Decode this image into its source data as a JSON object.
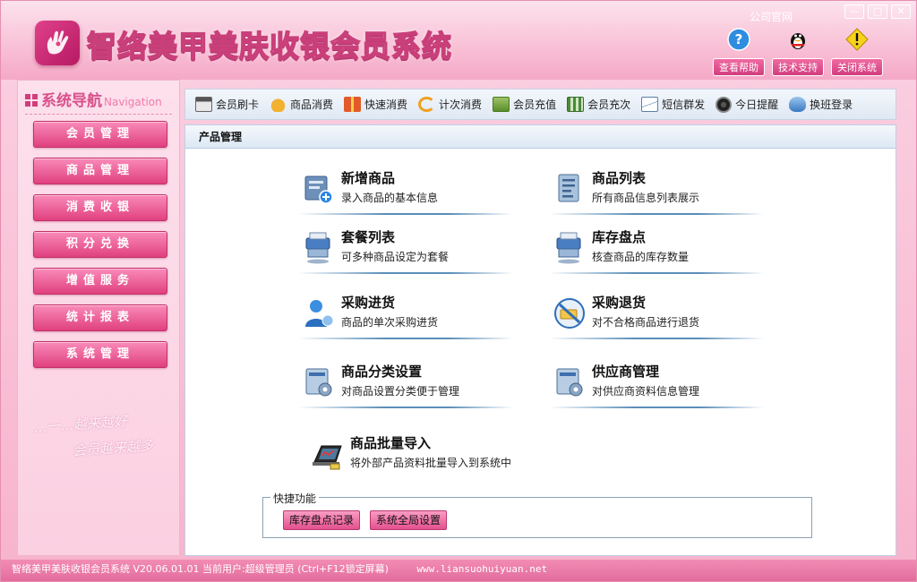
{
  "header": {
    "title": "智络美甲美肤收银会员系统",
    "official_site": "公司官网",
    "actions": [
      {
        "label": "查看帮助",
        "icon": "help-icon"
      },
      {
        "label": "技术支持",
        "icon": "qq-penguin-icon"
      },
      {
        "label": "关闭系统",
        "icon": "warning-icon"
      }
    ],
    "window_buttons": [
      "—",
      "□",
      "✕"
    ]
  },
  "sidebar": {
    "title": "系统导航",
    "title_en": "Navigation",
    "items": [
      "会员管理",
      "商品管理",
      "消费收银",
      "积分兑换",
      "增值服务",
      "统计报表",
      "系统管理"
    ],
    "slogan_line1": "…一…越来越好",
    "slogan_line2": "会员越来越多"
  },
  "toolbar": {
    "items": [
      {
        "label": "会员刷卡",
        "icon": "card-icon"
      },
      {
        "label": "商品消费",
        "icon": "money-bag-icon"
      },
      {
        "label": "快速消费",
        "icon": "gift-icon"
      },
      {
        "label": "计次消费",
        "icon": "refresh-icon"
      },
      {
        "label": "会员充值",
        "icon": "recharge-icon"
      },
      {
        "label": "会员充次",
        "icon": "film-icon"
      },
      {
        "label": "短信群发",
        "icon": "mail-icon"
      },
      {
        "label": "今日提醒",
        "icon": "clock-icon"
      },
      {
        "label": "换班登录",
        "icon": "switch-icon"
      }
    ]
  },
  "content": {
    "title": "产品管理",
    "functions": [
      {
        "name": "新增商品",
        "desc": "录入商品的基本信息",
        "icon": "add-product-icon"
      },
      {
        "name": "商品列表",
        "desc": "所有商品信息列表展示",
        "icon": "product-list-icon"
      },
      {
        "name": "套餐列表",
        "desc": "可多种商品设定为套餐",
        "icon": "package-list-icon"
      },
      {
        "name": "库存盘点",
        "desc": "核查商品的库存数量",
        "icon": "inventory-icon"
      },
      {
        "name": "采购进货",
        "desc": "商品的单次采购进货",
        "icon": "purchase-icon"
      },
      {
        "name": "采购退货",
        "desc": "对不合格商品进行退货",
        "icon": "return-icon"
      },
      {
        "name": "商品分类设置",
        "desc": "对商品设置分类便于管理",
        "icon": "category-settings-icon"
      },
      {
        "name": "供应商管理",
        "desc": "对供应商资料信息管理",
        "icon": "supplier-icon"
      },
      {
        "name": "商品批量导入",
        "desc": "将外部产品资料批量导入到系统中",
        "icon": "batch-import-icon"
      }
    ],
    "quick": {
      "legend": "快捷功能",
      "buttons": [
        "库存盘点记录",
        "系统全局设置"
      ]
    }
  },
  "status": {
    "text": "智络美甲美肤收银会员系统 V20.06.01.01 当前用户:超级管理员 (Ctrl+F12锁定屏幕)",
    "website": "www.liansuohuiyuan.net"
  },
  "colors": {
    "accent": "#e0407f",
    "pink_bg": "#f7b3cc",
    "toolbar_bg": "#dfe8f3"
  }
}
